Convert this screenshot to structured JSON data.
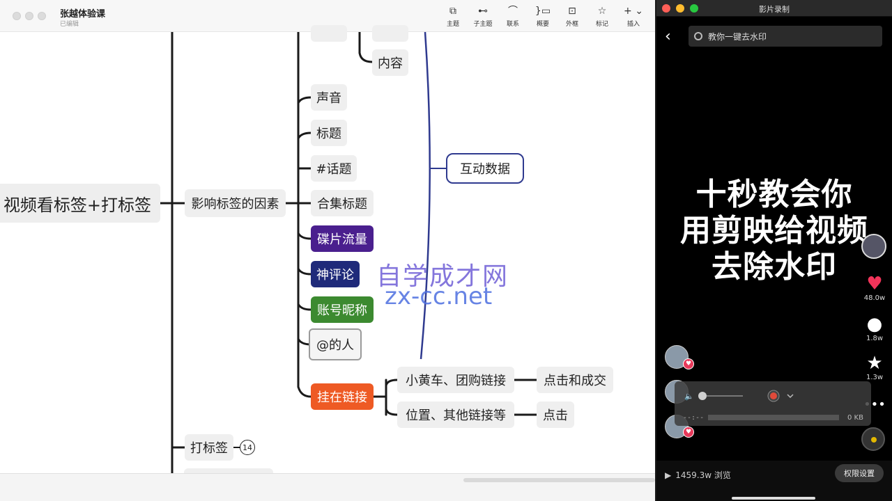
{
  "mindmap": {
    "doc_title": "张越体验课",
    "doc_status": "已编辑",
    "toolbar": [
      {
        "icon": "topic-icon",
        "glyph": "⧉",
        "label": "主题"
      },
      {
        "icon": "subtopic-icon",
        "glyph": "⊷",
        "label": "子主题"
      },
      {
        "icon": "relationship-icon",
        "glyph": "⌒",
        "label": "联系"
      },
      {
        "icon": "summary-icon",
        "glyph": "}▭",
        "label": "概要"
      },
      {
        "icon": "boundary-icon",
        "glyph": "⊡",
        "label": "外框"
      },
      {
        "icon": "marker-star-icon",
        "glyph": "☆",
        "label": "标记"
      },
      {
        "icon": "insert-plus-icon",
        "glyph": "+ ⌄",
        "label": "插入"
      }
    ],
    "nodes": {
      "root": "视频看标签+打标签",
      "factors": "影响标签的因素",
      "content": "内容",
      "sound": "声音",
      "title": "标题",
      "topic": "#话题",
      "collection": "合集标题",
      "traffic": "碟片流量",
      "comment": "神评论",
      "nickname": "账号昵称",
      "mention": "@的人",
      "link": "挂在链接",
      "cart": "小黄车、团购链接",
      "location": "位置、其他链接等",
      "click_deal": "点击和成交",
      "click": "点击",
      "interaction": "互动数据",
      "tagging": "打标签",
      "tagging_count": "14"
    },
    "watermark_line1": "自学成才网",
    "watermark_line2": "zx-cc.net",
    "colors": {
      "purple": "#4a1f8e",
      "navy": "#1f2a7a",
      "green": "#3c8a30",
      "orange": "#ee5a24",
      "bracket": "#2f3a8f"
    }
  },
  "video": {
    "window_title": "影片录制",
    "search_text": "教你一键去水印",
    "headline_line1": "十秒教会你",
    "headline_line2": "用剪映给视频",
    "headline_line3": "去除水印",
    "likes": "48.0w",
    "comments": "1.8w",
    "favorites": "1.3w",
    "recorder_time": "--:--",
    "recorder_size": "0 KB",
    "views": "1459.3w 浏览",
    "permission_button": "权限设置"
  }
}
